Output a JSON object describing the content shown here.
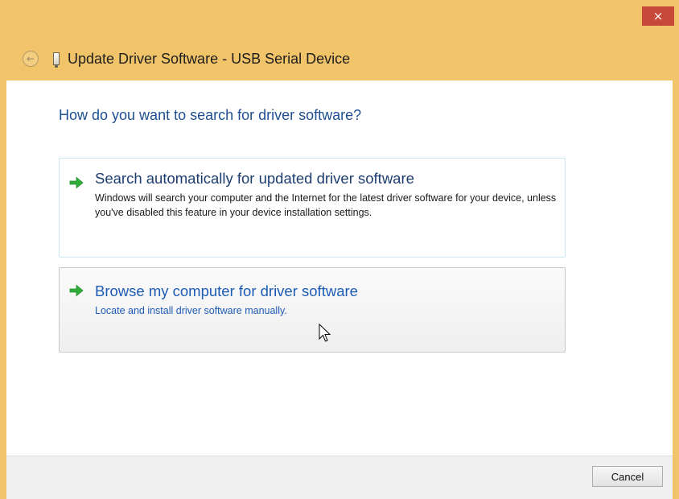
{
  "window": {
    "title": "Update Driver Software - USB Serial Device",
    "close_glyph": "×",
    "back_glyph": "←"
  },
  "main": {
    "question": "How do you want to search for driver software?",
    "options": [
      {
        "title": "Search automatically for updated driver software",
        "description": "Windows will search your computer and the Internet for the latest driver software for your device, unless you've disabled this feature in your device installation settings.",
        "icon": "green-arrow-icon"
      },
      {
        "title": "Browse my computer for driver software",
        "description": "Locate and install driver software manually.",
        "icon": "green-arrow-icon"
      }
    ]
  },
  "footer": {
    "cancel_label": "Cancel"
  },
  "colors": {
    "titlebar": "#f1c46a",
    "close_button": "#c7493a",
    "heading_blue": "#1d4f91",
    "link_blue": "#1d5bb5",
    "arrow_green": "#2fae3a"
  }
}
